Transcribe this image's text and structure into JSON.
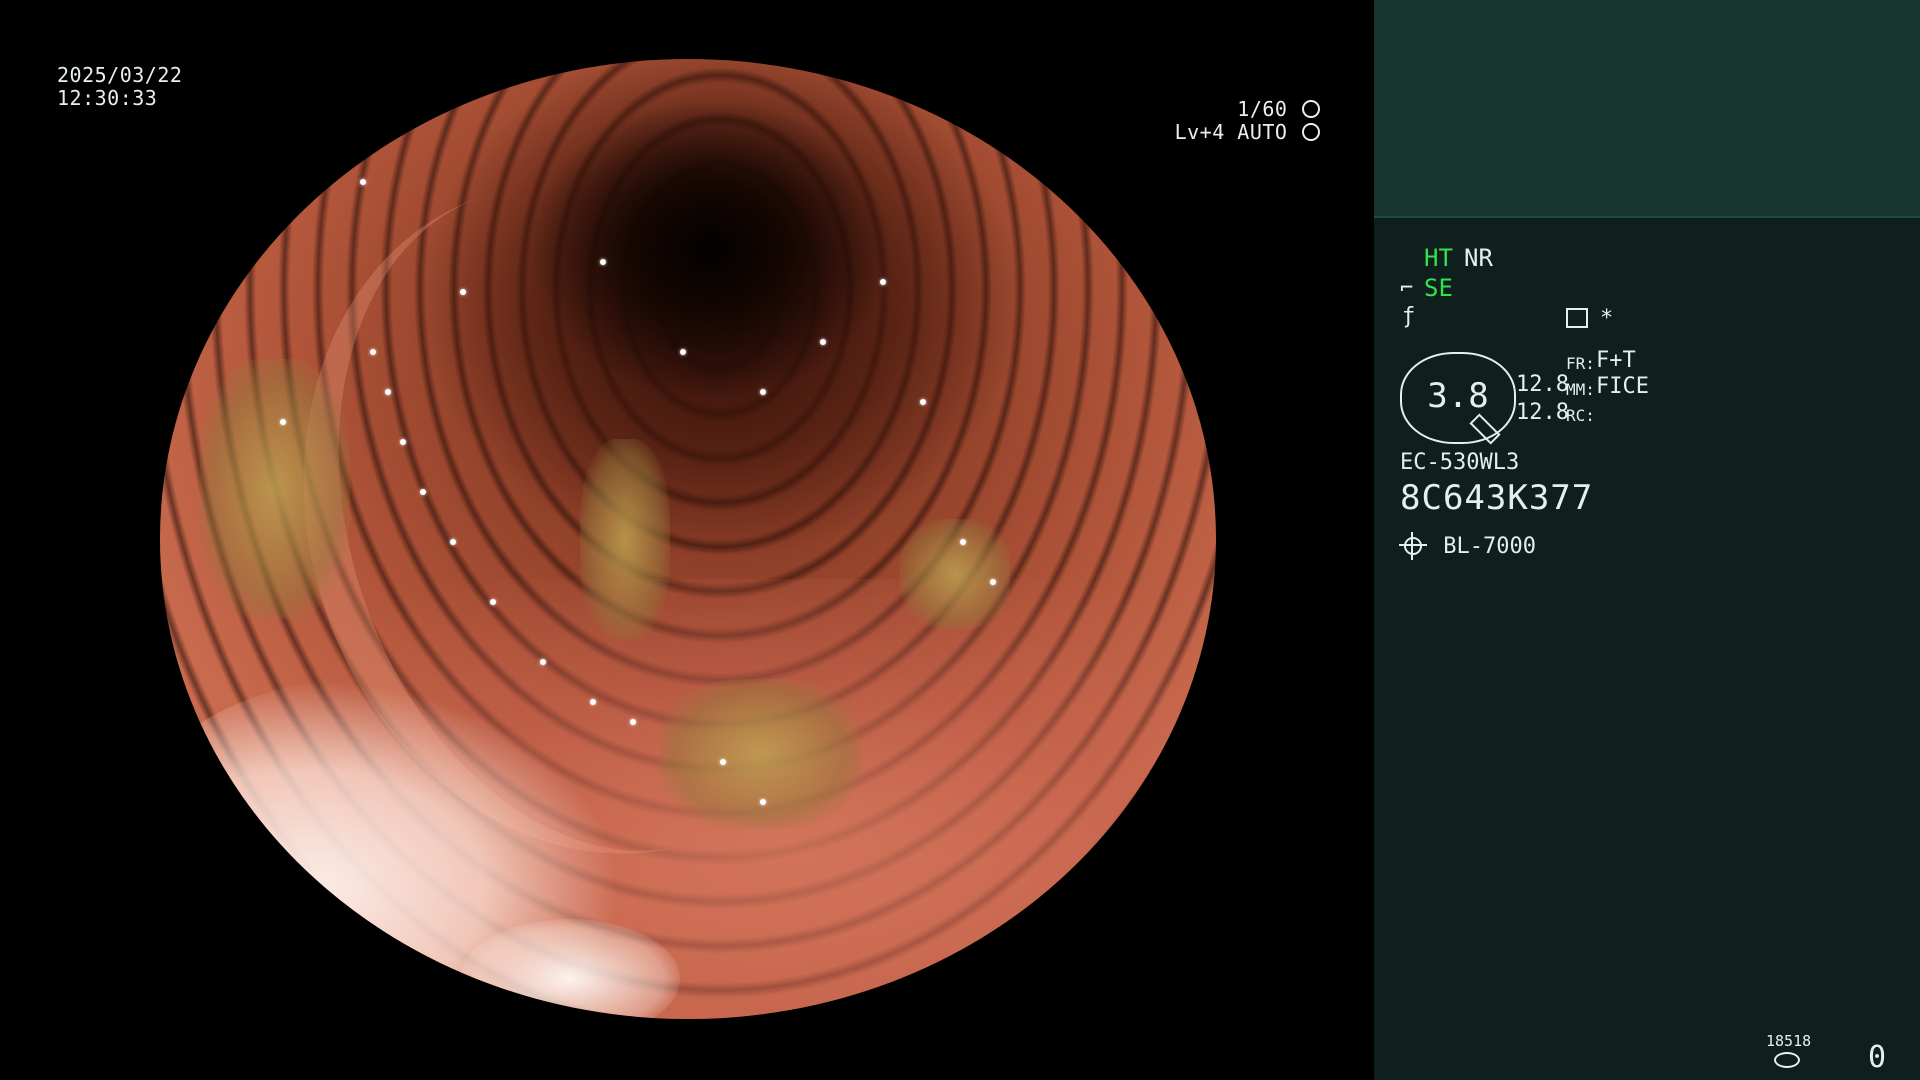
{
  "overlay": {
    "date": "2025/03/22",
    "time": "12:30:33",
    "shutter": "1/60",
    "level_mode": "Lv+4 AUTO"
  },
  "panel": {
    "ht_label": "HT",
    "nr_label": "NR",
    "se_label": "SE",
    "star": "*",
    "gauge_value": "3.8",
    "value_top": "12.8",
    "value_bottom": "12.8",
    "fr_label": "FR:",
    "fr_value": "F+T",
    "mm_label": "MM:",
    "mm_value": "FICE",
    "rc_label": "RC:",
    "scope_model": "EC-530WL3",
    "serial": "8C643K377",
    "light_source": "BL-7000",
    "counter": "18518",
    "count_zero": "0"
  },
  "colors": {
    "panel_bg": "#0e1f1d",
    "panel_top_bg": "#17362f",
    "status_green": "#35e04b"
  },
  "icons": {
    "shutter_icon": "aperture-icon",
    "level_icon": "ring-icon",
    "scope_icon": "endoscope-icon",
    "function_icon": "function-icon",
    "menu_icon": "menu-icon",
    "light_icon": "sun-icon",
    "storage_icon": "disk-icon"
  }
}
